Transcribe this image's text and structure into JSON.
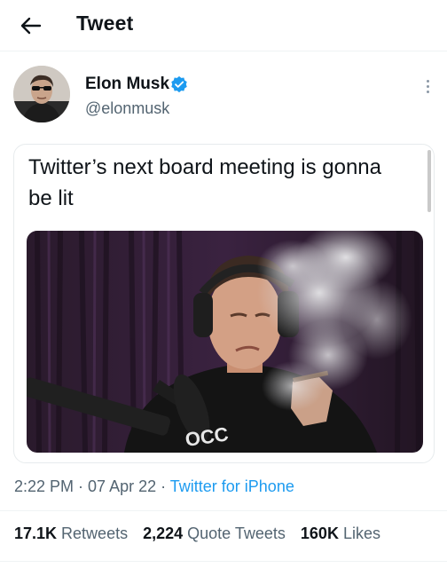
{
  "header": {
    "title": "Tweet",
    "back_icon": "arrow-left-icon"
  },
  "author": {
    "name": "Elon Musk",
    "handle": "@elonmusk",
    "verified": true,
    "verified_color": "#1d9bf0",
    "menu_icon": "more-vertical-icon"
  },
  "tweet": {
    "text": "Twitter’s next board meeting is gonna be lit",
    "media_alt": "photo-of-man-with-headphones-and-smoke",
    "media_caption_fragment": "OCC"
  },
  "meta": {
    "time": "2:22 PM",
    "sep1": " · ",
    "date": "07 Apr 22",
    "sep2": " · ",
    "source": "Twitter for iPhone"
  },
  "stats": {
    "retweets": {
      "count": "17.1K",
      "label": " Retweets"
    },
    "quote_tweets": {
      "count": "2,224",
      "label": " Quote Tweets"
    },
    "likes": {
      "count": "160K",
      "label": " Likes"
    }
  },
  "colors": {
    "link": "#1d9bf0",
    "secondary_text": "#536471",
    "primary_text": "#0f1419"
  }
}
